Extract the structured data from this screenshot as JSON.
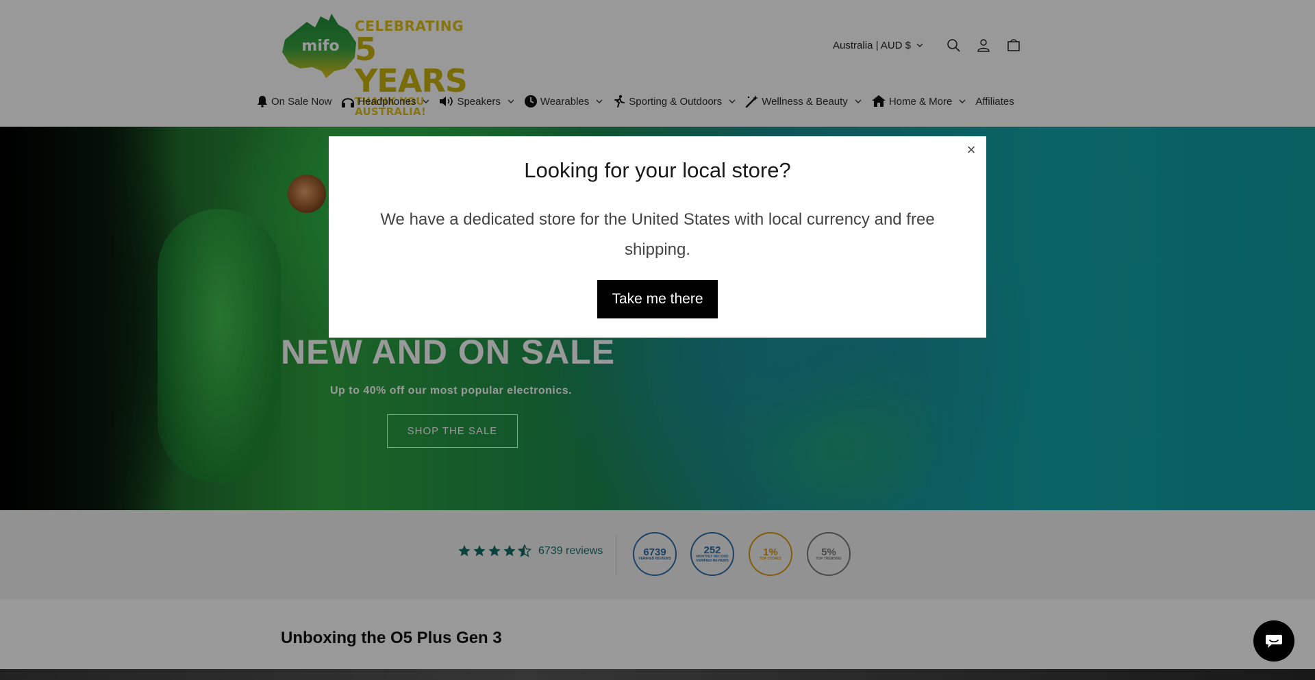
{
  "header": {
    "logo": {
      "line1": "CELEBRATING",
      "line2": "5 YEARS",
      "line3": "THANK YOU AUSTRALIA!",
      "brand": "mifo"
    },
    "country_selector": "Australia | AUD $",
    "icons": [
      "search-icon",
      "account-icon",
      "cart-icon"
    ]
  },
  "nav": {
    "items": [
      {
        "label": "On Sale Now",
        "icon": "bell-icon",
        "dropdown": false
      },
      {
        "label": "Headphones",
        "icon": "headphones-icon",
        "dropdown": true
      },
      {
        "label": "Speakers",
        "icon": "speaker-icon",
        "dropdown": true
      },
      {
        "label": "Wearables",
        "icon": "clock-icon",
        "dropdown": true
      },
      {
        "label": "Sporting & Outdoors",
        "icon": "running-icon",
        "dropdown": true
      },
      {
        "label": "Wellness & Beauty",
        "icon": "wand-icon",
        "dropdown": true
      },
      {
        "label": "Home & More",
        "icon": "home-icon",
        "dropdown": true
      },
      {
        "label": "Affiliates",
        "icon": "",
        "dropdown": false
      }
    ]
  },
  "hero": {
    "title": "NEW AND ON SALE",
    "subtitle": "Up to 40% off our most popular electronics.",
    "cta": "SHOP THE SALE"
  },
  "reviews": {
    "rating": 4.5,
    "count_text": "6739 reviews",
    "badges": [
      {
        "number": "6739",
        "caption": "VERIFIED REVIEWS",
        "color": "#2f6fa8"
      },
      {
        "number": "252",
        "caption": "MONTHLY RECORD VERIFIED REVIEWS",
        "color": "#2f6fa8"
      },
      {
        "number": "1%",
        "caption": "TOP STORES",
        "color": "#d79a12"
      },
      {
        "number": "5%",
        "caption": "TOP TRENDING",
        "color": "#7a7a7a"
      }
    ]
  },
  "section": {
    "title": "Unboxing the O5 Plus Gen 3"
  },
  "modal": {
    "title": "Looking for your local store?",
    "body": "We have a dedicated store for the United States with local currency and free shipping.",
    "button": "Take me there",
    "close": "×"
  },
  "colors": {
    "accent_teal": "#176d6a",
    "modal_button": "#000000",
    "overlay": "rgba(0,0,0,0.4)"
  }
}
